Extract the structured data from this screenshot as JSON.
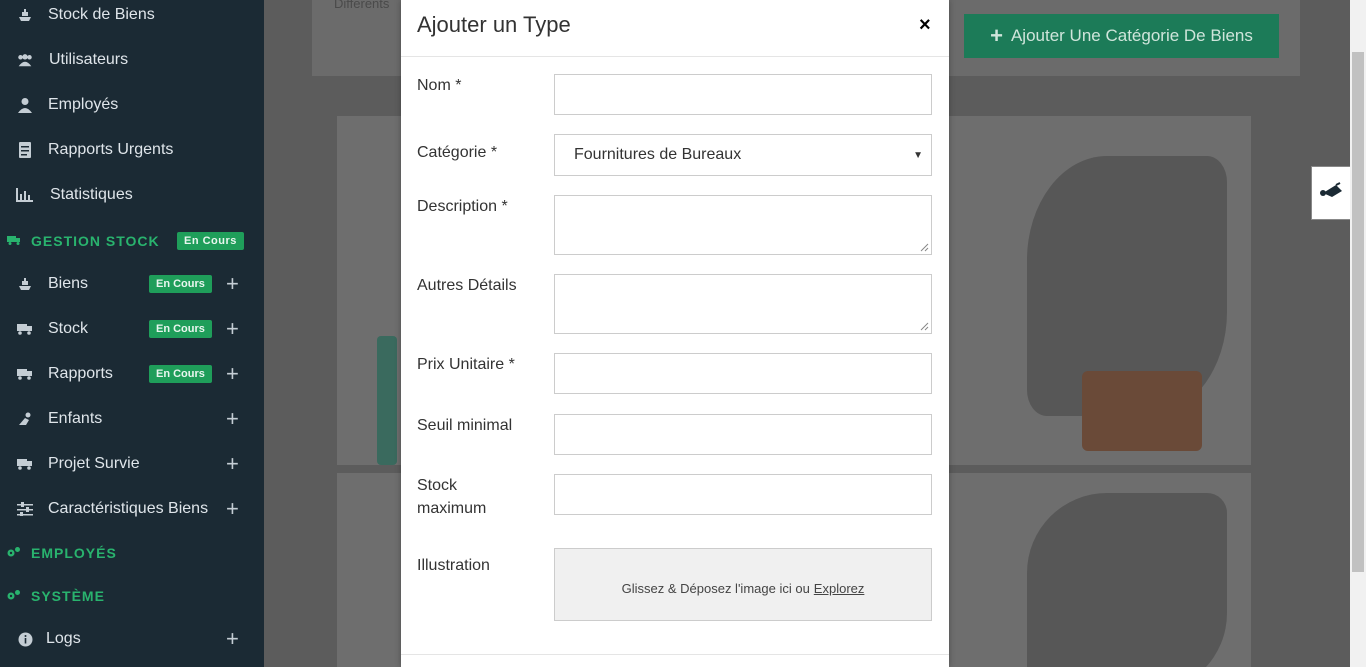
{
  "sidebar": {
    "items": [
      {
        "label": "Stock de Biens",
        "icon": "ship-icon"
      },
      {
        "label": "Utilisateurs",
        "icon": "users-icon"
      },
      {
        "label": "Employés",
        "icon": "employee-icon"
      },
      {
        "label": "Rapports Urgents",
        "icon": "report-icon"
      },
      {
        "label": "Statistiques",
        "icon": "chart-icon"
      }
    ],
    "section_stock": {
      "label": "GESTION STOCK",
      "badge": "En Cours"
    },
    "stock_items": [
      {
        "label": "Biens",
        "badge": "En Cours"
      },
      {
        "label": "Stock",
        "badge": "En Cours"
      },
      {
        "label": "Rapports",
        "badge": "En Cours"
      },
      {
        "label": "Enfants"
      },
      {
        "label": "Projet Survie"
      },
      {
        "label": "Caractéristiques Biens"
      }
    ],
    "section_employes": {
      "label": "EMPLOYÉS"
    },
    "section_systeme": {
      "label": "SYSTÈME"
    },
    "logs": {
      "label": "Logs"
    },
    "plus": "+"
  },
  "background": {
    "partial_text": "Differents",
    "add_category_button": "Ajouter Une Catégorie De Biens"
  },
  "modal": {
    "title": "Ajouter un Type",
    "close": "×",
    "fields": {
      "nom": {
        "label": "Nom *",
        "value": ""
      },
      "categorie": {
        "label": "Catégorie *",
        "value": "Fournitures de Bureaux"
      },
      "description": {
        "label": "Description *",
        "value": ""
      },
      "autres": {
        "label": "Autres Détails",
        "value": ""
      },
      "prix": {
        "label": "Prix Unitaire *",
        "value": ""
      },
      "seuil": {
        "label": "Seuil minimal",
        "value": ""
      },
      "stock_max": {
        "label_line1": "Stock",
        "label_line2": "maximum",
        "value": ""
      },
      "illustration": {
        "label": "Illustration",
        "drop_text": "Glissez & Déposez l'image ici ou",
        "browse": "Explorez"
      }
    }
  },
  "colors": {
    "sidebar_bg": "#1b2a34",
    "accent_green": "#29b36e",
    "badge_green": "#1f9e5a"
  }
}
